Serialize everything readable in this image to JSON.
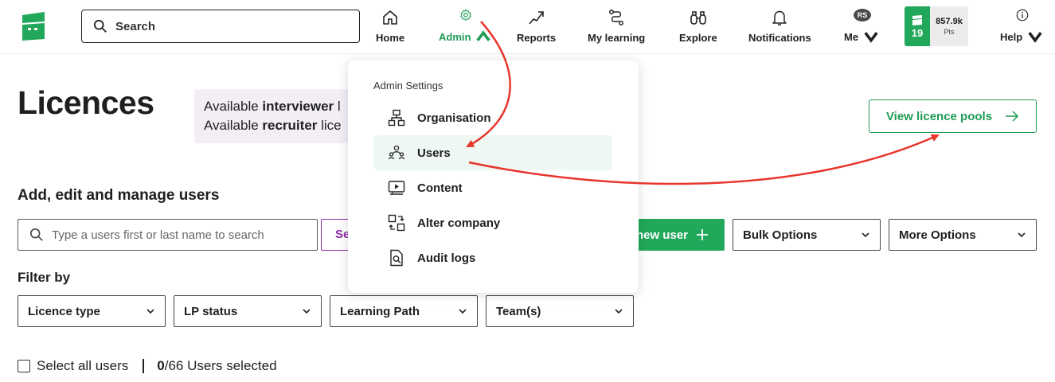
{
  "nav": {
    "search_placeholder": "Search",
    "items": [
      {
        "label": "Home",
        "icon": "home-icon"
      },
      {
        "label": "Admin",
        "icon": "gear-icon",
        "active": true
      },
      {
        "label": "Reports",
        "icon": "trend-up-icon"
      },
      {
        "label": "My learning",
        "icon": "path-icon"
      },
      {
        "label": "Explore",
        "icon": "binoculars-icon"
      },
      {
        "label": "Notifications",
        "icon": "bell-icon"
      },
      {
        "label": "Me",
        "icon": "avatar"
      },
      {
        "label": "Help",
        "icon": "info-icon"
      }
    ],
    "avatar_initials": "RS",
    "level": "19",
    "points_value": "857.9k",
    "points_unit": "Pts"
  },
  "page": {
    "title": "Licences",
    "info_line1_prefix": "Available ",
    "info_line1_bold": "interviewer",
    "info_line1_suffix": " l",
    "info_line2_prefix": "Available ",
    "info_line2_bold": "recruiter",
    "info_line2_suffix": " lice",
    "view_pools_label": "View licence pools",
    "section_title": "Add, edit and manage users",
    "user_search_placeholder": "Type a users first or last name to search",
    "search_button_label": "Se",
    "add_user_label": "new user",
    "bulk_options_label": "Bulk Options",
    "more_options_label": "More Options",
    "filter_label": "Filter by",
    "filters": [
      "Licence type",
      "LP status",
      "Learning Path",
      "Team(s)"
    ],
    "select_all_label": "Select all users",
    "selected_count": "0",
    "selected_suffix": "/66 Users selected"
  },
  "admin_menu": {
    "title": "Admin Settings",
    "items": [
      {
        "label": "Organisation",
        "icon": "org-chart-icon"
      },
      {
        "label": "Users",
        "icon": "users-icon",
        "highlighted": true
      },
      {
        "label": "Content",
        "icon": "video-icon"
      },
      {
        "label": "Alter company",
        "icon": "switch-company-icon"
      },
      {
        "label": "Audit logs",
        "icon": "document-search-icon"
      }
    ]
  },
  "colors": {
    "brand_green": "#22a85a",
    "text_green": "#1e9b55",
    "purple": "#8a2aa6",
    "info_bg": "#f3eef6",
    "annotation_red": "#e8352b"
  }
}
